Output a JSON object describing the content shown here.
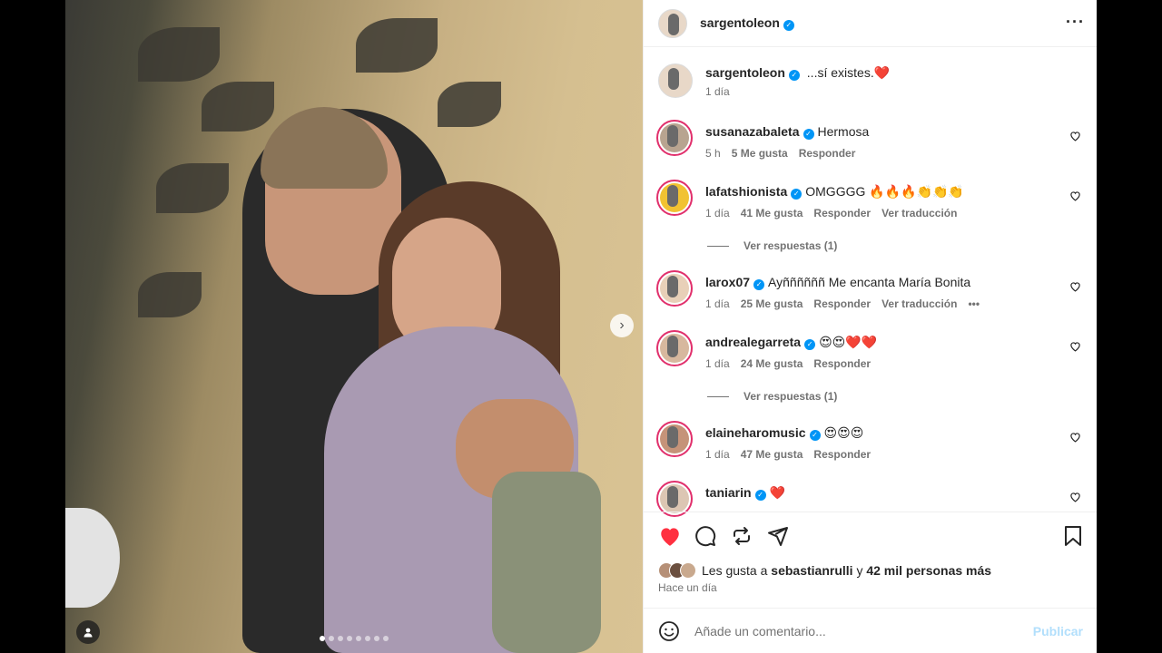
{
  "post": {
    "author": "sargentoleon",
    "caption": "...sí existes.❤️",
    "caption_time": "1 día",
    "slides_count": 8,
    "active_slide": 0
  },
  "comments": [
    {
      "user": "susanazabaleta",
      "text": "Hermosa",
      "time": "5 h",
      "likes": "5 Me gusta",
      "reply": "Responder",
      "translate": ""
    },
    {
      "user": "lafatshionista",
      "text": "OMGGGG 🔥🔥🔥👏👏👏",
      "time": "1 día",
      "likes": "41 Me gusta",
      "reply": "Responder",
      "translate": "Ver traducción"
    },
    {
      "user": "larox07",
      "text": "Ayññññññ Me encanta María Bonita",
      "time": "1 día",
      "likes": "25 Me gusta",
      "reply": "Responder",
      "translate": "Ver traducción"
    },
    {
      "user": "andrealegarreta",
      "text": "😍😍❤️❤️",
      "time": "1 día",
      "likes": "24 Me gusta",
      "reply": "Responder",
      "translate": ""
    },
    {
      "user": "elaineharomusic",
      "text": "😍😍😍",
      "time": "1 día",
      "likes": "47 Me gusta",
      "reply": "Responder",
      "translate": ""
    },
    {
      "user": "taniarin",
      "text": "❤️",
      "time": "",
      "likes": "",
      "reply": "",
      "translate": ""
    }
  ],
  "replies": [
    {
      "label": "Ver respuestas (1)"
    },
    {
      "label": "Ver respuestas (1)"
    }
  ],
  "likes": {
    "prefix": "Les gusta a",
    "user": "sebastianrulli",
    "joiner": "y",
    "others": "42 mil personas más"
  },
  "time_ago": "Hace un día",
  "comment_box": {
    "placeholder": "Añade un comentario...",
    "publish": "Publicar"
  },
  "colors": {
    "like_red": "#ff3040",
    "verified_blue": "#0095f6",
    "publish_disabled": "#b2dffc"
  }
}
